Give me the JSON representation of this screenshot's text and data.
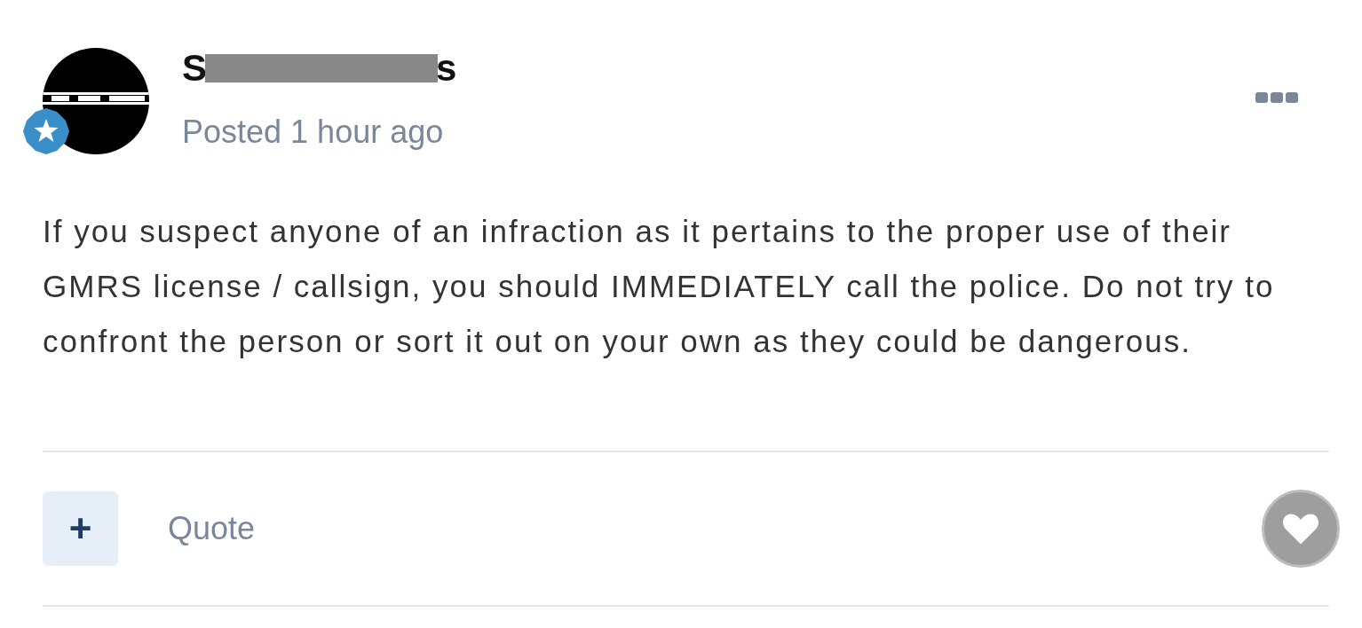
{
  "post": {
    "author": {
      "name_start": "S",
      "name_end": "s",
      "redacted": true
    },
    "posted": "Posted 1 hour ago",
    "body": "If you suspect anyone of an infraction as it pertains to the proper use of their GMRS license / callsign, you should IMMEDIATELY call the police. Do not try to confront the person or sort it out on your own as they could be dangerous."
  },
  "actions": {
    "multiquote": "+",
    "quote": "Quote",
    "liked": false
  }
}
